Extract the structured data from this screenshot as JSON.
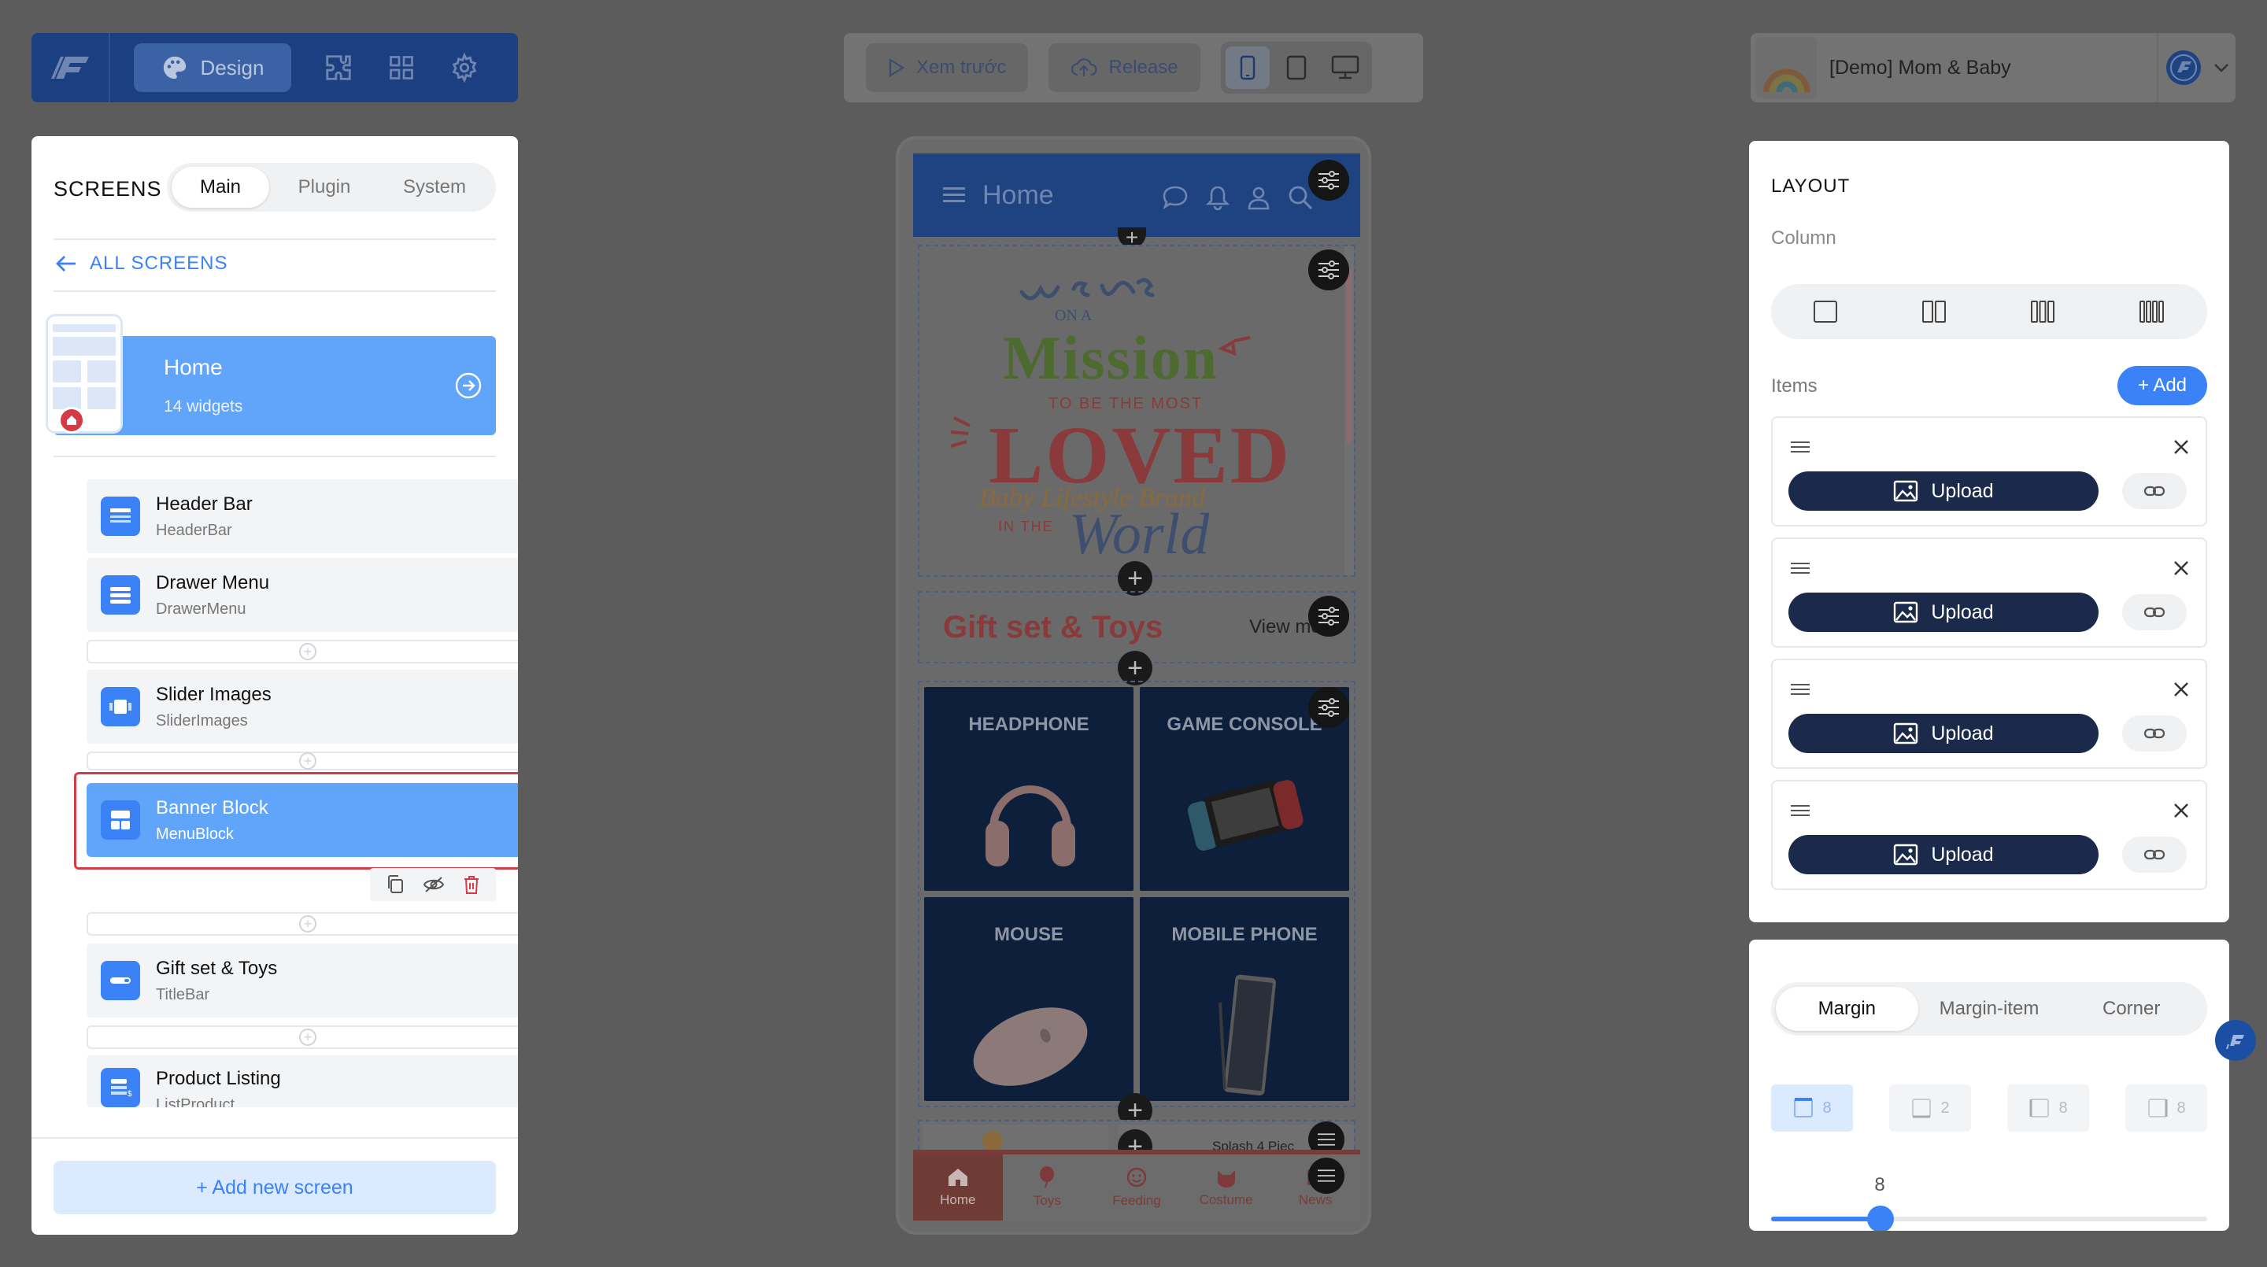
{
  "toolbar": {
    "design_label": "Design",
    "preview_label": "Xem trước",
    "release_label": "Release",
    "project_name": "[Demo] Mom & Baby"
  },
  "left_panel": {
    "title": "SCREENS",
    "tabs": [
      "Main",
      "Plugin",
      "System"
    ],
    "all_screens": "ALL SCREENS",
    "home": {
      "name": "Home",
      "count": "14 widgets"
    },
    "widgets": [
      {
        "title": "Header Bar",
        "type": "HeaderBar"
      },
      {
        "title": "Drawer Menu",
        "type": "DrawerMenu"
      },
      {
        "title": "Slider Images",
        "type": "SliderImages"
      },
      {
        "title": "Banner Block",
        "type": "MenuBlock"
      },
      {
        "title": "Gift set & Toys",
        "type": "TitleBar"
      },
      {
        "title": "Product Listing",
        "type": "ListProduct"
      }
    ],
    "add_screen": "+ Add new screen"
  },
  "phone": {
    "header_title": "Home",
    "title_bar": {
      "title": "Gift set & Toys",
      "view_more": "View more"
    },
    "grid_tiles": [
      "HEADPHONE",
      "GAME CONSOLE",
      "MOUSE",
      "MOBILE PHONE"
    ],
    "partial_product": "Splash 4 Piec",
    "nav": [
      "Home",
      "Toys",
      "Feeding",
      "Costume",
      "News"
    ]
  },
  "right_panel": {
    "layout_title": "LAYOUT",
    "column_label": "Column",
    "items_label": "Items",
    "add_label": "+ Add",
    "upload_label": "Upload",
    "spacing_tabs": [
      "Margin",
      "Margin-item",
      "Corner"
    ],
    "margins": [
      "8",
      "2",
      "8",
      "8"
    ],
    "slider_value": "8"
  },
  "colors": {
    "accent": "#3b82f6",
    "selected_border": "#d43b45",
    "brand": "#1b3f80"
  }
}
